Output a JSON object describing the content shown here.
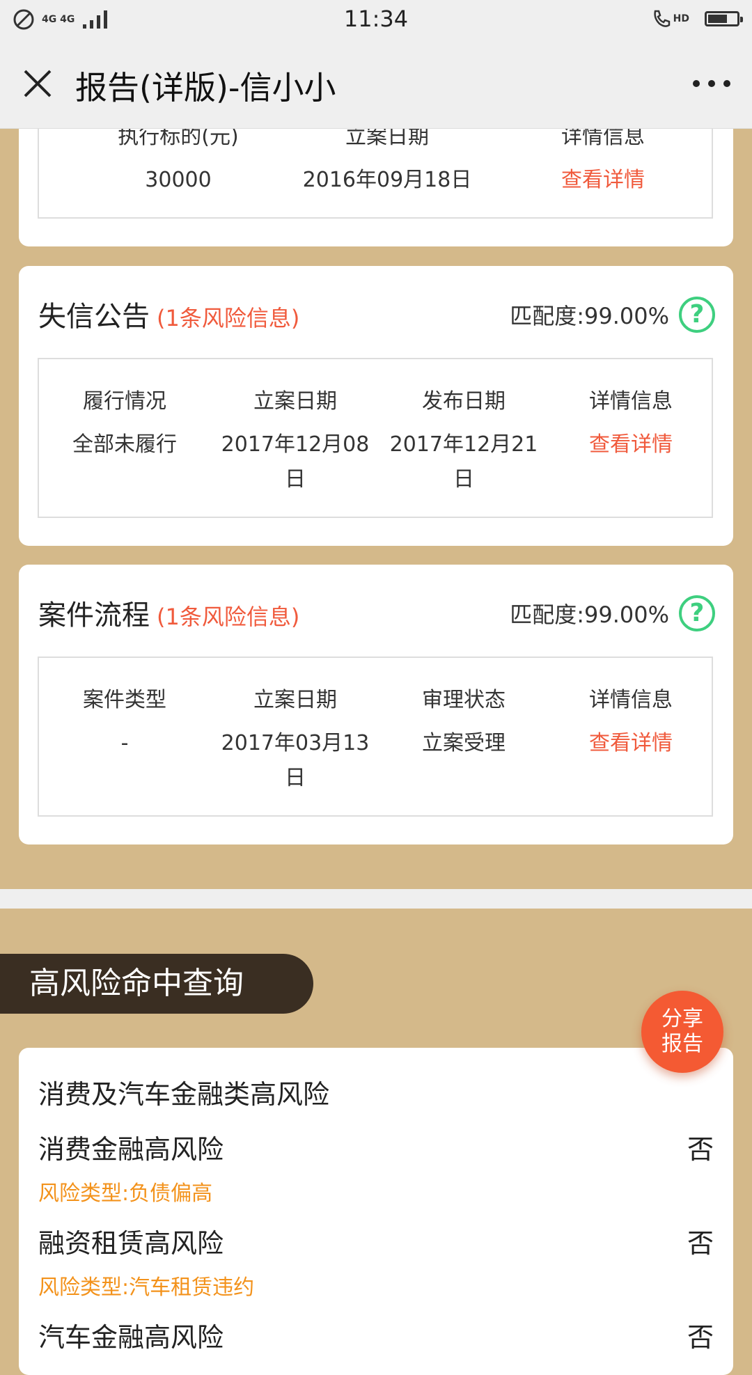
{
  "status_bar": {
    "time": "11:34",
    "network": "4G 4G",
    "call_label": "HD"
  },
  "title_bar": {
    "title": "报告(详版)-信小小"
  },
  "top_card": {
    "headers": [
      "执行标的(元)",
      "立案日期",
      "详情信息"
    ],
    "values": [
      "30000",
      "2016年09月18日",
      "查看详情"
    ]
  },
  "dishonest_card": {
    "title": "失信公告",
    "risk": "(1条风险信息)",
    "match": "匹配度:99.00%",
    "headers": [
      "履行情况",
      "立案日期",
      "发布日期",
      "详情信息"
    ],
    "values": [
      "全部未履行",
      "2017年12月08日",
      "2017年12月21日",
      "查看详情"
    ]
  },
  "case_card": {
    "title": "案件流程",
    "risk": "(1条风险信息)",
    "match": "匹配度:99.00%",
    "headers": [
      "案件类型",
      "立案日期",
      "审理状态",
      "详情信息"
    ],
    "values": [
      "-",
      "2017年03月13日",
      "立案受理",
      "查看详情"
    ]
  },
  "high_risk_section": {
    "tag": "高风险命中查询",
    "category": "消费及汽车金融类高风险",
    "items": [
      {
        "name": "消费金融高风险",
        "type": "风险类型:负债偏高",
        "answer": "否"
      },
      {
        "name": "融资租赁高风险",
        "type": "风险类型:汽车租赁违约",
        "answer": "否"
      },
      {
        "name": "汽车金融高风险",
        "type": "",
        "answer": "否"
      }
    ]
  },
  "share_button": {
    "line1": "分享",
    "line2": "报告"
  },
  "colors": {
    "background": "#d4b98a",
    "risk_red": "#f05a3c",
    "match_green": "#3ecf7f",
    "type_orange": "#f3921b",
    "section_dark": "#3a2e22"
  }
}
